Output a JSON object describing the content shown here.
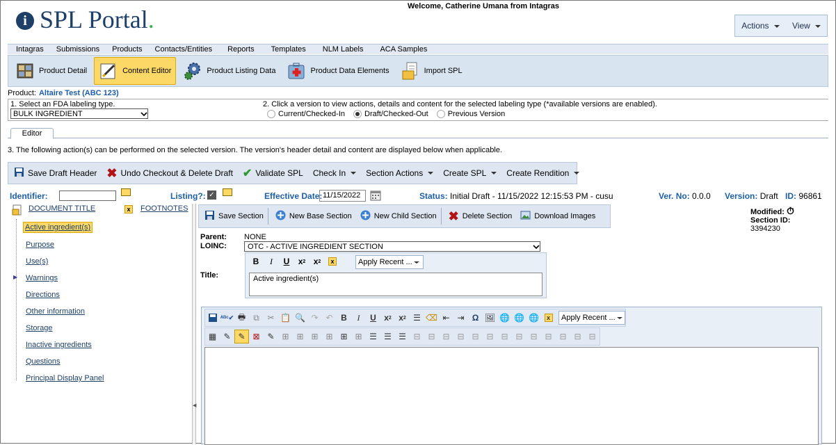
{
  "header": {
    "logo_text": "SPL Portal",
    "logo_dot": ".",
    "welcome": "Welcome, Catherine Umana from Intagras",
    "menu": {
      "actions": "Actions",
      "view": "View"
    }
  },
  "mainnav": [
    "Intagras",
    "Submissions",
    "Products",
    "Contacts/Entities",
    "Reports",
    "Templates",
    "NLM Labels",
    "ACA Samples"
  ],
  "toolbar": {
    "product_detail": "Product Detail",
    "content_editor": "Content Editor",
    "product_listing": "Product Listing Data",
    "product_data": "Product Data Elements",
    "import_spl": "Import SPL"
  },
  "product": {
    "label": "Product:",
    "value": "Altaire Test (ABC 123)"
  },
  "step1": {
    "label": "1. Select an FDA labeling type.",
    "selected": "BULK INGREDIENT"
  },
  "step2": {
    "label": "2. Click a version to view actions, details and content for the selected labeling type (*available versions are enabled).",
    "options": [
      "Current/Checked-In",
      "Draft/Checked-Out",
      "Previous Version"
    ]
  },
  "tab": {
    "editor": "Editor"
  },
  "step3": "3. The following action(s) can be performed on the selected version. The version's header detail and content are displayed below when applicable.",
  "actions": {
    "save_draft": "Save Draft Header",
    "undo": "Undo Checkout & Delete Draft",
    "validate": "Validate SPL",
    "check_in": "Check In",
    "section_actions": "Section Actions",
    "create_spl": "Create SPL",
    "create_rendition": "Create Rendition"
  },
  "idrow": {
    "identifier_label": "Identifier:",
    "listing_label": "Listing?:",
    "effective_label": "Effective Date:",
    "effective_value": "11/15/2022",
    "status_label": "Status:",
    "status_value": "Initial Draft - 11/15/2022 12:15:53 PM - cusu",
    "verno_label": "Ver. No:",
    "verno_value": "0.0.0",
    "version_label": "Version:",
    "version_value": "Draft",
    "id_label": "ID:",
    "id_value": "96861"
  },
  "tree": {
    "document_title": "DOCUMENT TITLE",
    "footnotes": "FOOTNOTES",
    "items": [
      "Active ingredient(s)",
      "Purpose",
      "Use(s)",
      "Warnings",
      "Directions",
      "Other information",
      "Storage",
      "Inactive ingredients",
      "Questions",
      "Principal Display Panel"
    ]
  },
  "section": {
    "save": "Save Section",
    "new_base": "New Base Section",
    "new_child": "New Child Section",
    "delete": "Delete Section",
    "download": "Download Images",
    "modified_label": "Modified:",
    "section_id_label": "Section ID:",
    "section_id_value": "3394230",
    "parent_label": "Parent:",
    "parent_value": "NONE",
    "loinc_label": "LOINC:",
    "loinc_value": "OTC - ACTIVE INGREDIENT SECTION",
    "title_label": "Title:",
    "title_value": "Active ingredient(s)",
    "apply_recent": "Apply Recent ..."
  },
  "rte": {
    "apply_recent": "Apply Recent ..."
  },
  "colors": {
    "accent_blue": "#1d5fa8",
    "highlight": "#fcd967",
    "logo_blue": "#1d3f68",
    "logo_green": "#3bb44a"
  }
}
